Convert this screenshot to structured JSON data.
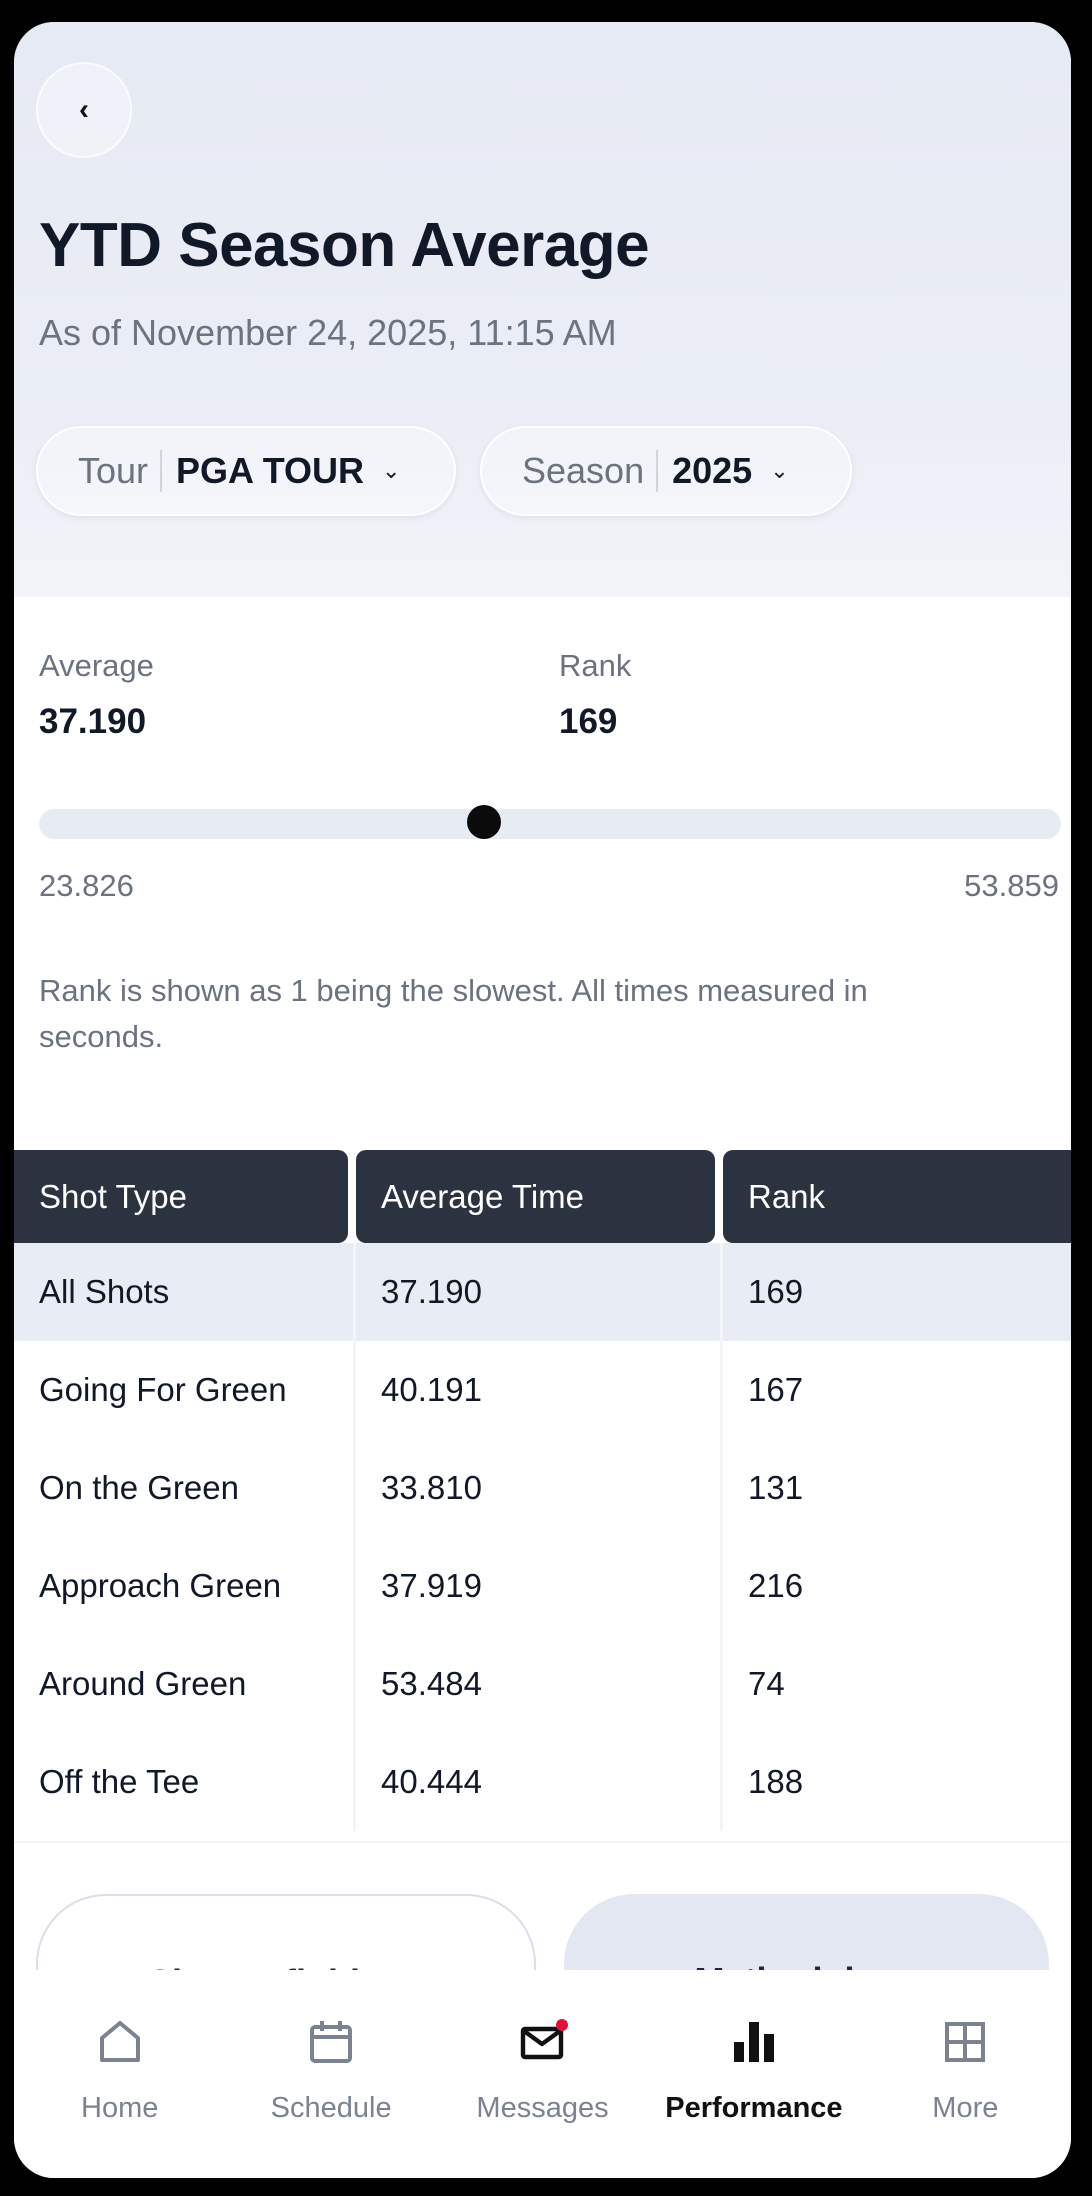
{
  "header": {
    "title": "YTD Season Average",
    "subtitle": "As of November 24, 2025, 11:15 AM",
    "back_icon_glyph": "‹"
  },
  "filters": {
    "tour": {
      "label": "Tour",
      "value": "PGA TOUR"
    },
    "season": {
      "label": "Season",
      "value": "2025"
    },
    "chevron_glyph": "⌄"
  },
  "summary": {
    "average_label": "Average",
    "average_value": "37.190",
    "rank_label": "Rank",
    "rank_value": "169",
    "range": {
      "min": "23.826",
      "max": "53.859",
      "value": 37.19,
      "fraction": 0.435
    },
    "note": "Rank is shown as 1 being the slowest. All times measured in seconds."
  },
  "table": {
    "headers": [
      "Shot Type",
      "Average Time",
      "Rank"
    ],
    "rows": [
      {
        "type": "All Shots",
        "avg": "37.190",
        "rank": "169"
      },
      {
        "type": "Going For Green",
        "avg": "40.191",
        "rank": "167"
      },
      {
        "type": "On the Green",
        "avg": "33.810",
        "rank": "131"
      },
      {
        "type": "Approach Green",
        "avg": "37.919",
        "rank": "216"
      },
      {
        "type": "Around Green",
        "avg": "53.484",
        "rank": "74"
      },
      {
        "type": "Off the Tee",
        "avg": "40.444",
        "rank": "188"
      }
    ]
  },
  "buttons": {
    "definitions": "Shot Definitions",
    "methodology": "Methodology"
  },
  "tabbar": {
    "items": [
      {
        "label": "Home",
        "icon": "home-icon"
      },
      {
        "label": "Schedule",
        "icon": "calendar-icon"
      },
      {
        "label": "Messages",
        "icon": "mail-icon"
      },
      {
        "label": "Performance",
        "icon": "bar-chart-icon"
      },
      {
        "label": "More",
        "icon": "grid-icon"
      }
    ],
    "active": "Performance",
    "badge_color": "#e0123c"
  }
}
